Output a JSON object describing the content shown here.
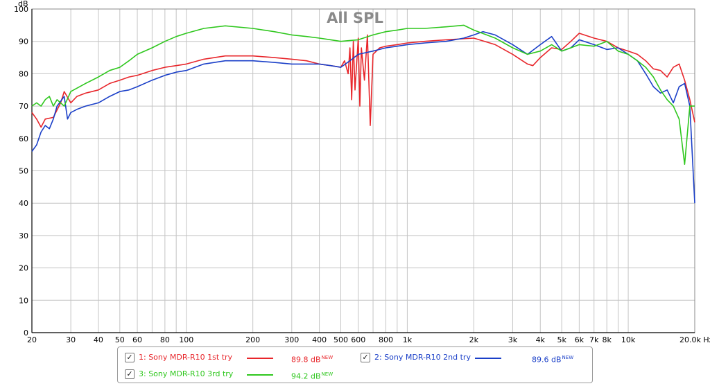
{
  "chart_data": {
    "type": "line",
    "title": "All SPL",
    "ylabel": "dB",
    "xunit": "Hz",
    "xscale": "log",
    "xlim": [
      20,
      20000
    ],
    "ylim": [
      0,
      100
    ],
    "grid": true,
    "legend_position": "bottom",
    "y_ticks": [
      "0",
      "10",
      "20",
      "30",
      "40",
      "50",
      "60",
      "70",
      "80",
      "90",
      "100"
    ],
    "x_ticks": [
      {
        "f": 20,
        "label": "20"
      },
      {
        "f": 30,
        "label": "30"
      },
      {
        "f": 40,
        "label": "40"
      },
      {
        "f": 50,
        "label": "50"
      },
      {
        "f": 60,
        "label": "60"
      },
      {
        "f": 80,
        "label": "80"
      },
      {
        "f": 100,
        "label": "100"
      },
      {
        "f": 200,
        "label": "200"
      },
      {
        "f": 300,
        "label": "300"
      },
      {
        "f": 400,
        "label": "400"
      },
      {
        "f": 500,
        "label": "500"
      },
      {
        "f": 600,
        "label": "600"
      },
      {
        "f": 800,
        "label": "800"
      },
      {
        "f": 1000,
        "label": "1k"
      },
      {
        "f": 2000,
        "label": "2k"
      },
      {
        "f": 3000,
        "label": "3k"
      },
      {
        "f": 4000,
        "label": "4k"
      },
      {
        "f": 5000,
        "label": "5k"
      },
      {
        "f": 6000,
        "label": "6k"
      },
      {
        "f": 7000,
        "label": "7k"
      },
      {
        "f": 8000,
        "label": "8k"
      },
      {
        "f": 10000,
        "label": "10k"
      },
      {
        "f": 20000,
        "label": "20.0k Hz"
      }
    ],
    "series": [
      {
        "name": "1: Sony MDR-R10 1st try",
        "color": "#e8262b",
        "level": "89.8 dB",
        "points": [
          [
            20,
            68
          ],
          [
            21,
            66
          ],
          [
            22,
            63.5
          ],
          [
            23,
            66
          ],
          [
            25,
            66.5
          ],
          [
            27,
            71
          ],
          [
            28,
            74.5
          ],
          [
            30,
            71
          ],
          [
            32,
            73
          ],
          [
            35,
            74
          ],
          [
            40,
            75
          ],
          [
            45,
            77
          ],
          [
            50,
            78
          ],
          [
            55,
            79
          ],
          [
            60,
            79.5
          ],
          [
            70,
            81
          ],
          [
            80,
            82
          ],
          [
            90,
            82.5
          ],
          [
            100,
            83
          ],
          [
            120,
            84.5
          ],
          [
            150,
            85.5
          ],
          [
            200,
            85.5
          ],
          [
            250,
            85
          ],
          [
            300,
            84.5
          ],
          [
            350,
            84
          ],
          [
            400,
            83
          ],
          [
            450,
            82.5
          ],
          [
            500,
            82
          ],
          [
            520,
            84
          ],
          [
            540,
            80
          ],
          [
            550,
            88
          ],
          [
            560,
            72
          ],
          [
            570,
            90
          ],
          [
            580,
            75
          ],
          [
            600,
            91
          ],
          [
            610,
            70
          ],
          [
            620,
            88
          ],
          [
            640,
            78
          ],
          [
            660,
            92
          ],
          [
            680,
            64
          ],
          [
            700,
            86
          ],
          [
            750,
            88
          ],
          [
            800,
            88.5
          ],
          [
            900,
            89
          ],
          [
            1000,
            89.5
          ],
          [
            1200,
            90
          ],
          [
            1500,
            90.5
          ],
          [
            2000,
            91
          ],
          [
            2500,
            89
          ],
          [
            3000,
            86
          ],
          [
            3500,
            83
          ],
          [
            3700,
            82.5
          ],
          [
            4000,
            85
          ],
          [
            4500,
            88
          ],
          [
            5000,
            87.5
          ],
          [
            5500,
            90
          ],
          [
            6000,
            92.5
          ],
          [
            7000,
            91
          ],
          [
            8000,
            90
          ],
          [
            9000,
            88
          ],
          [
            10000,
            87
          ],
          [
            11000,
            86
          ],
          [
            12000,
            84
          ],
          [
            13000,
            81.5
          ],
          [
            14000,
            81
          ],
          [
            15000,
            79
          ],
          [
            16000,
            82
          ],
          [
            17000,
            83
          ],
          [
            18000,
            78
          ],
          [
            19000,
            72
          ],
          [
            20000,
            65
          ]
        ]
      },
      {
        "name": "2: Sony MDR-R10 2nd try",
        "color": "#1a3fc8",
        "level": "89.6 dB",
        "points": [
          [
            20,
            56
          ],
          [
            21,
            58
          ],
          [
            22,
            62
          ],
          [
            23,
            64
          ],
          [
            24,
            63
          ],
          [
            25,
            66
          ],
          [
            26,
            70
          ],
          [
            28,
            73
          ],
          [
            29,
            66
          ],
          [
            30,
            68
          ],
          [
            32,
            69
          ],
          [
            35,
            70
          ],
          [
            40,
            71
          ],
          [
            45,
            73
          ],
          [
            50,
            74.5
          ],
          [
            55,
            75
          ],
          [
            60,
            76
          ],
          [
            70,
            78
          ],
          [
            80,
            79.5
          ],
          [
            90,
            80.5
          ],
          [
            100,
            81
          ],
          [
            120,
            83
          ],
          [
            150,
            84
          ],
          [
            200,
            84
          ],
          [
            250,
            83.5
          ],
          [
            300,
            83
          ],
          [
            350,
            83
          ],
          [
            400,
            83
          ],
          [
            450,
            82.5
          ],
          [
            500,
            82
          ],
          [
            550,
            84
          ],
          [
            600,
            86
          ],
          [
            700,
            87
          ],
          [
            800,
            88
          ],
          [
            900,
            88.5
          ],
          [
            1000,
            89
          ],
          [
            1200,
            89.5
          ],
          [
            1500,
            90
          ],
          [
            1800,
            91
          ],
          [
            2000,
            92
          ],
          [
            2200,
            93
          ],
          [
            2500,
            92
          ],
          [
            3000,
            89
          ],
          [
            3500,
            86
          ],
          [
            4000,
            89
          ],
          [
            4500,
            91.5
          ],
          [
            5000,
            87
          ],
          [
            5500,
            88
          ],
          [
            6000,
            90.5
          ],
          [
            7000,
            89
          ],
          [
            8000,
            87.5
          ],
          [
            9000,
            88
          ],
          [
            10000,
            86
          ],
          [
            11000,
            84
          ],
          [
            12000,
            80
          ],
          [
            13000,
            76
          ],
          [
            14000,
            74
          ],
          [
            15000,
            75
          ],
          [
            16000,
            71
          ],
          [
            17000,
            76
          ],
          [
            18000,
            77
          ],
          [
            19000,
            70
          ],
          [
            20000,
            40
          ]
        ]
      },
      {
        "name": "3: Sony MDR-R10 3rd try",
        "color": "#2ec71d",
        "level": "94.2 dB",
        "points": [
          [
            20,
            70
          ],
          [
            21,
            71
          ],
          [
            22,
            70
          ],
          [
            23,
            72
          ],
          [
            24,
            73
          ],
          [
            25,
            70
          ],
          [
            26,
            72
          ],
          [
            28,
            70
          ],
          [
            30,
            74.5
          ],
          [
            35,
            77
          ],
          [
            40,
            79
          ],
          [
            45,
            81
          ],
          [
            50,
            82
          ],
          [
            55,
            84
          ],
          [
            60,
            86
          ],
          [
            70,
            88
          ],
          [
            80,
            90
          ],
          [
            90,
            91.5
          ],
          [
            100,
            92.5
          ],
          [
            120,
            94
          ],
          [
            150,
            94.8
          ],
          [
            200,
            94
          ],
          [
            250,
            93
          ],
          [
            300,
            92
          ],
          [
            350,
            91.5
          ],
          [
            400,
            91
          ],
          [
            450,
            90.5
          ],
          [
            500,
            90
          ],
          [
            600,
            90.5
          ],
          [
            700,
            92
          ],
          [
            800,
            93
          ],
          [
            900,
            93.5
          ],
          [
            1000,
            94
          ],
          [
            1200,
            94
          ],
          [
            1500,
            94.5
          ],
          [
            1800,
            95
          ],
          [
            2000,
            93.5
          ],
          [
            2500,
            91
          ],
          [
            3000,
            88
          ],
          [
            3500,
            86
          ],
          [
            4000,
            87
          ],
          [
            4500,
            89
          ],
          [
            5000,
            87
          ],
          [
            5500,
            88
          ],
          [
            6000,
            89
          ],
          [
            7000,
            88.5
          ],
          [
            8000,
            90
          ],
          [
            9000,
            87
          ],
          [
            10000,
            86
          ],
          [
            11000,
            84
          ],
          [
            12000,
            82
          ],
          [
            13000,
            79
          ],
          [
            14000,
            75
          ],
          [
            15000,
            72
          ],
          [
            16000,
            70
          ],
          [
            17000,
            66
          ],
          [
            18000,
            52
          ],
          [
            19000,
            70
          ],
          [
            20000,
            70
          ]
        ]
      }
    ]
  }
}
